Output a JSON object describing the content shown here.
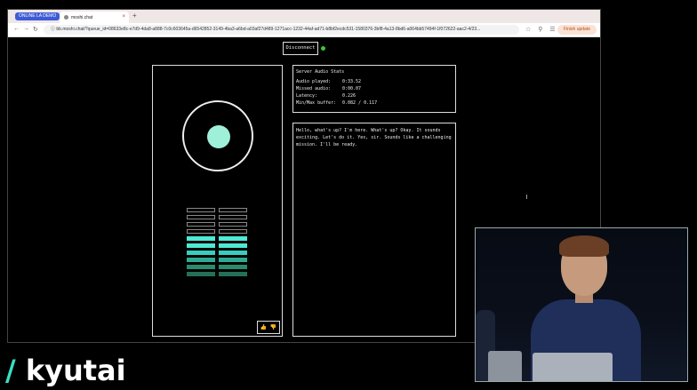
{
  "browser": {
    "badge": "ONLINE LA DEMO",
    "tab_title": "moshi.chat",
    "tab_close": "×",
    "new_tab": "+",
    "nav_back": "←",
    "nav_forward": "→",
    "nav_reload": "↻",
    "url": "ⓘ  bb.moshi.chat/?queue_id=08633e8c-e7d9-4da8-a888-7c0c603645a-d6542852-3149-4ba3-a6bd-a03af27d489-1271acc-1232-44af-ad71-b8bf2ecdc531-1580376-3bf8-4a13-8bd6-a064bb57494f-1f072622-aac2-4/23...",
    "icons": "☆ ⚲ ☰",
    "finish_update": "Finish update"
  },
  "app": {
    "disconnect_label": "Disconnect",
    "feedback_icons": "👍 👎",
    "stats": {
      "title": "Server Audio Stats",
      "rows": [
        {
          "label": "Audio played:",
          "value": "0:33.52"
        },
        {
          "label": "Missed audio:",
          "value": "0:00.07"
        },
        {
          "label": "Latency:",
          "value": "0.226"
        },
        {
          "label": "Min/Max buffer:",
          "value": "0.082 / 0.117"
        }
      ]
    },
    "transcript": "Hello, what's up? I'm here. What's up? Okay. It sounds exciting. Let's do it. Yes, sir. Sounds like a challenging mission. I'll be ready.",
    "meter": {
      "total_rows": 10,
      "active_rows": 6
    }
  },
  "logo": {
    "slash": "/",
    "text": "kyutai"
  },
  "colors": {
    "accent": "#38e0c4",
    "orb": "#9ff0d8",
    "status": "#33cc33",
    "badge": "#3d5bd6"
  }
}
